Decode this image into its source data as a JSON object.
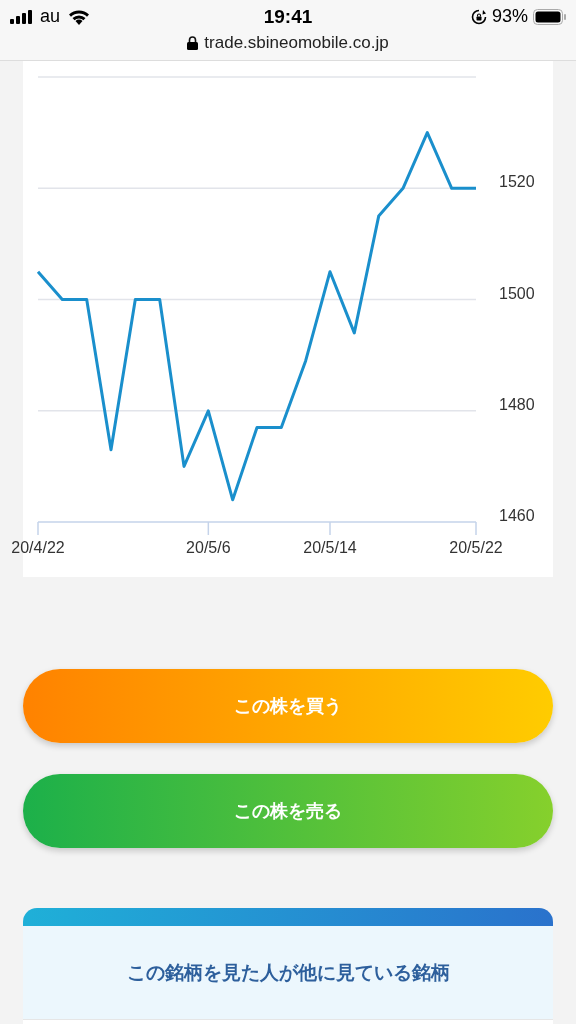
{
  "status_bar": {
    "carrier": "au",
    "time": "19:41",
    "battery": "93%"
  },
  "address_bar": {
    "url": "trade.sbineomobile.co.jp"
  },
  "price_chart": {
    "chart_data": {
      "type": "line",
      "categories": [
        "20/4/22",
        null,
        null,
        null,
        null,
        null,
        null,
        "20/5/6",
        null,
        null,
        null,
        null,
        "20/5/14",
        null,
        null,
        null,
        null,
        null,
        "20/5/22"
      ],
      "series": [
        {
          "color": "#1a8fcc",
          "values": [
            1505,
            1500,
            1500,
            1473,
            1500,
            1500,
            1470,
            1480,
            1464,
            1477,
            1477,
            1489,
            1505,
            1494,
            1515,
            1520,
            1530,
            1520,
            1520
          ]
        }
      ],
      "ylim": [
        1460,
        1540
      ],
      "grid": true,
      "yticks": [
        1460,
        1480,
        1500,
        1520
      ]
    }
  },
  "buttons": [
    {
      "kind": "buy",
      "label": "この株を買う"
    },
    {
      "kind": "sell",
      "label": "この株を売る"
    }
  ],
  "related_section": {
    "title": "この銘柄を見た人が他に見ている銘柄"
  }
}
